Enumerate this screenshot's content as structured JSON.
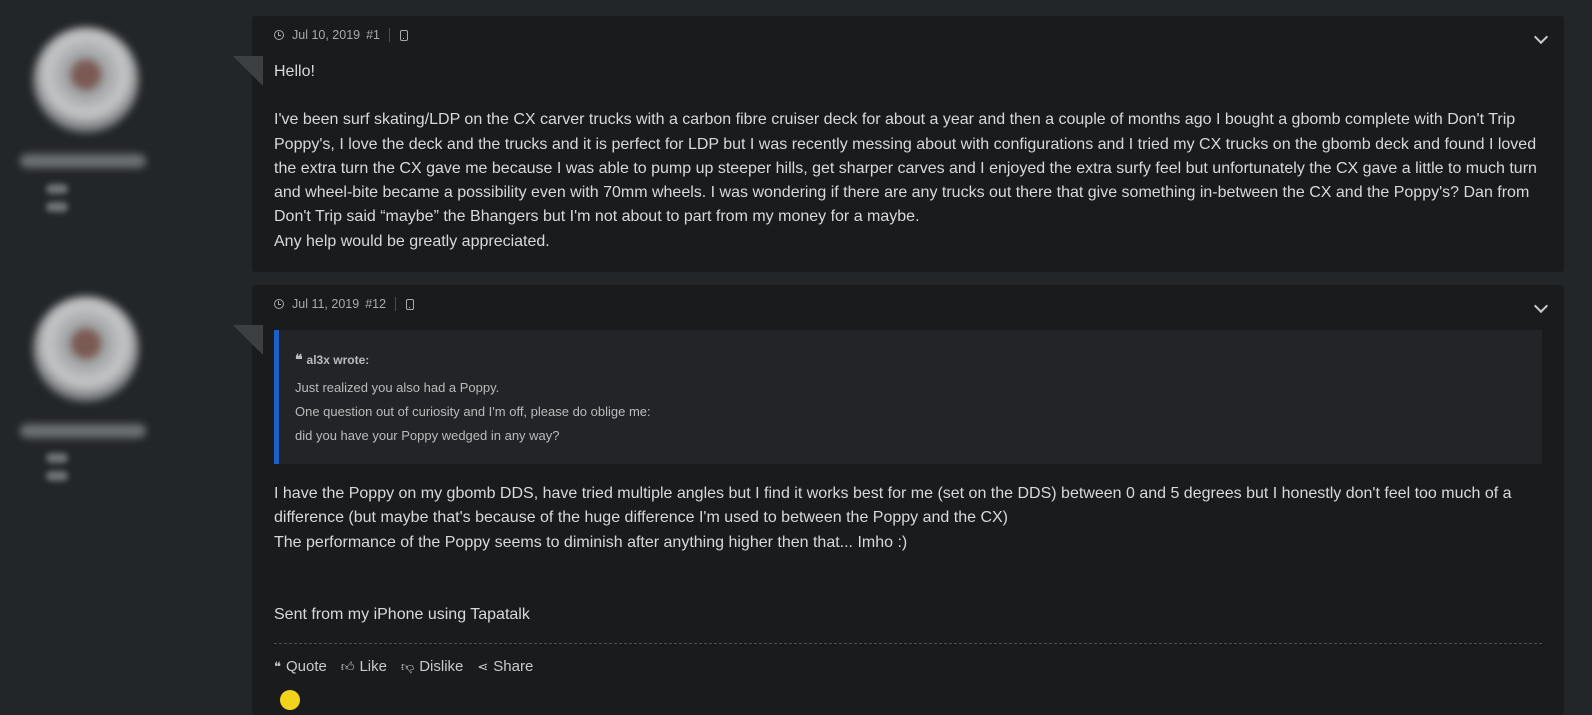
{
  "posts": [
    {
      "date": "Jul 10, 2019",
      "number": "#1",
      "paragraphs": [
        "Hello!",
        "",
        "I've been surf skating/LDP on the CX carver trucks with a carbon fibre cruiser deck for about a year and then a couple of months ago I bought a gbomb complete with Don't Trip Poppy's, I love the deck and the trucks and it is perfect for LDP but I was recently messing about with configurations and I tried my CX trucks on the gbomb deck and found I loved the extra turn the CX gave me because I was able to pump up steeper hills, get sharper carves and I enjoyed the extra surfy feel but unfortunately the CX gave a little to much turn and wheel-bite became a possibility even with 70mm wheels. I was wondering if there are any trucks out there that give something in-between the CX and the Poppy's? Dan from Don't Trip said “maybe” the Bhangers but I'm not about to part from my money for a maybe.",
        "Any help would be greatly appreciated."
      ]
    },
    {
      "date": "Jul 11, 2019",
      "number": "#12",
      "quote": {
        "author": "al3x wrote:",
        "lines": [
          "Just realized you also had a Poppy.",
          "One question out of curiosity and I'm off, please do oblige me:",
          "did you have your Poppy wedged in any way?"
        ]
      },
      "paragraphs": [
        "I have the Poppy on my gbomb DDS, have tried multiple angles but I find it works best for me (set on the DDS) between 0 and 5 degrees but I honestly don't feel too much of a difference (but maybe that's because of the huge difference I'm used to between the Poppy and the CX)",
        "The performance of the Poppy seems to diminish after anything higher then that... Imho :)",
        "",
        "",
        "Sent from my iPhone using Tapatalk"
      ],
      "actions": {
        "quote": "Quote",
        "like": "Like",
        "dislike": "Dislike",
        "share": "Share"
      }
    }
  ],
  "colors": {
    "page_bg": "#232628",
    "post_bg": "#1a1b1c",
    "quote_bar": "#1f5ec7",
    "quote_bg": "#222427"
  },
  "icons": [
    "clock-icon",
    "mobile-device-icon",
    "chevron-down-icon",
    "quote-mark-icon",
    "thumbs-up-icon",
    "thumbs-down-icon",
    "share-icon"
  ]
}
